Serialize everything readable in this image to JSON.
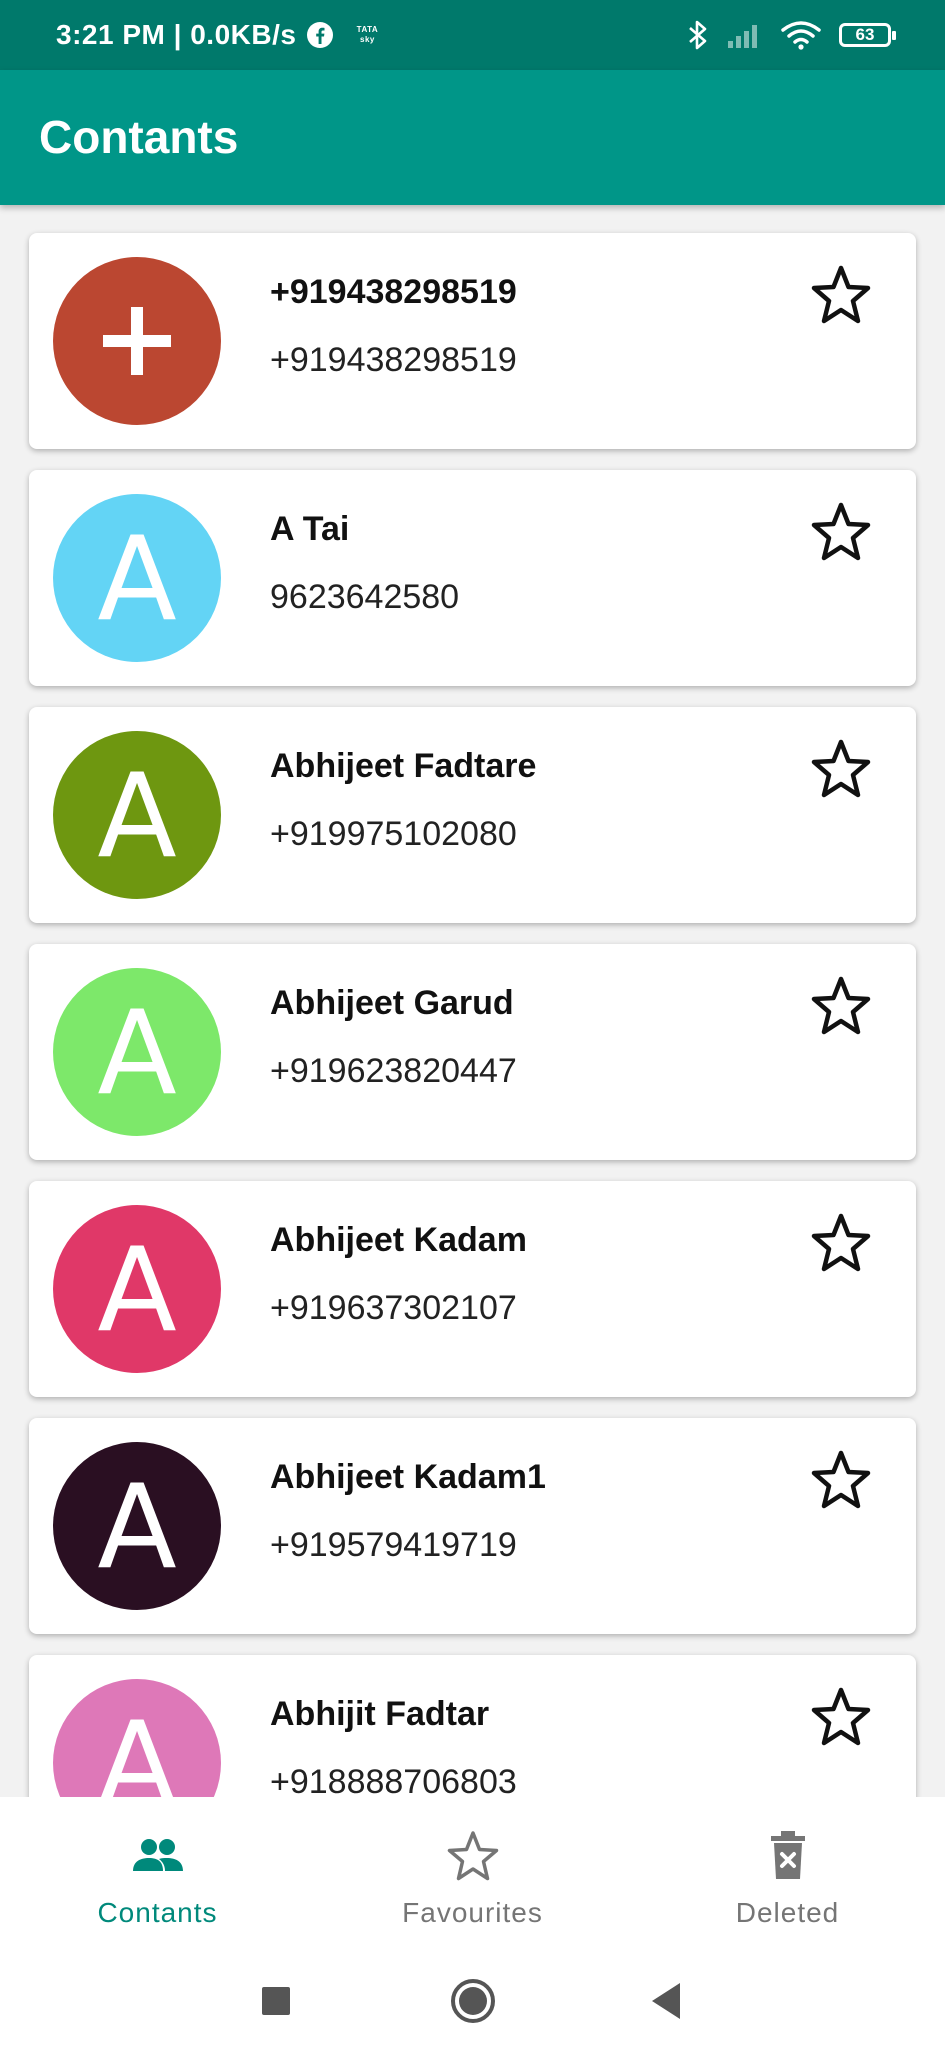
{
  "status_bar": {
    "time_speed": "3:21 PM | 0.0KB/s",
    "carrier_badge_line1": "TATA",
    "carrier_badge_line2": "sky",
    "battery": "63"
  },
  "app_bar": {
    "title": "Contants"
  },
  "contacts": [
    {
      "name": "+919438298519",
      "phone": "+919438298519",
      "avatar_letter": "+",
      "avatar_color": "#bb4731"
    },
    {
      "name": "A Tai",
      "phone": "9623642580",
      "avatar_letter": "A",
      "avatar_color": "#63d4f5"
    },
    {
      "name": "Abhijeet Fadtare",
      "phone": "+919975102080",
      "avatar_letter": "A",
      "avatar_color": "#6e9710"
    },
    {
      "name": "Abhijeet Garud",
      "phone": "+919623820447",
      "avatar_letter": "A",
      "avatar_color": "#7de86a"
    },
    {
      "name": "Abhijeet Kadam",
      "phone": "+919637302107",
      "avatar_letter": "A",
      "avatar_color": "#e03868"
    },
    {
      "name": "Abhijeet Kadam1",
      "phone": "+919579419719",
      "avatar_letter": "A",
      "avatar_color": "#2a0f22"
    },
    {
      "name": "Abhijit Fadtar",
      "phone": "+918888706803",
      "avatar_letter": "A",
      "avatar_color": "#de78b8"
    }
  ],
  "bottom_nav": {
    "items": [
      {
        "label": "Contants",
        "icon": "people-icon",
        "active": true
      },
      {
        "label": "Favourites",
        "icon": "star-outline-icon",
        "active": false
      },
      {
        "label": "Deleted",
        "icon": "trash-icon",
        "active": false
      }
    ]
  },
  "colors": {
    "status_bar": "#00796b",
    "app_bar": "#009688",
    "accent": "#00897b",
    "inactive": "#757575"
  }
}
